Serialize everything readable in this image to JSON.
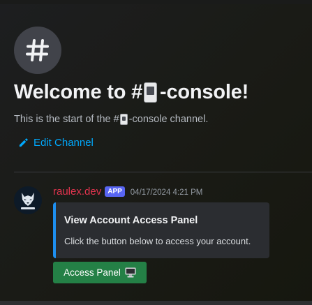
{
  "channel": {
    "welcome_prefix": "Welcome to #",
    "welcome_suffix": "-console!",
    "start_prefix": "This is the start of the #",
    "start_suffix": "-console channel.",
    "edit_label": "Edit Channel",
    "hash_icon": "hash-icon",
    "channel_emoji": "mobile-phone-icon"
  },
  "message": {
    "username": "raulex.dev",
    "badge": "APP",
    "timestamp": "04/17/2024 4:21 PM",
    "avatar_icon": "wolf-logo",
    "embed": {
      "title": "View Account Access Panel",
      "description": "Click the button below to access your account.",
      "accent": "#1e8ff0"
    },
    "button": {
      "label": "Access Panel",
      "icon": "desktop-computer-icon",
      "color": "#248046"
    }
  },
  "colors": {
    "username": "#e1344e",
    "link": "#00a8fc",
    "badge": "#5865f2"
  }
}
